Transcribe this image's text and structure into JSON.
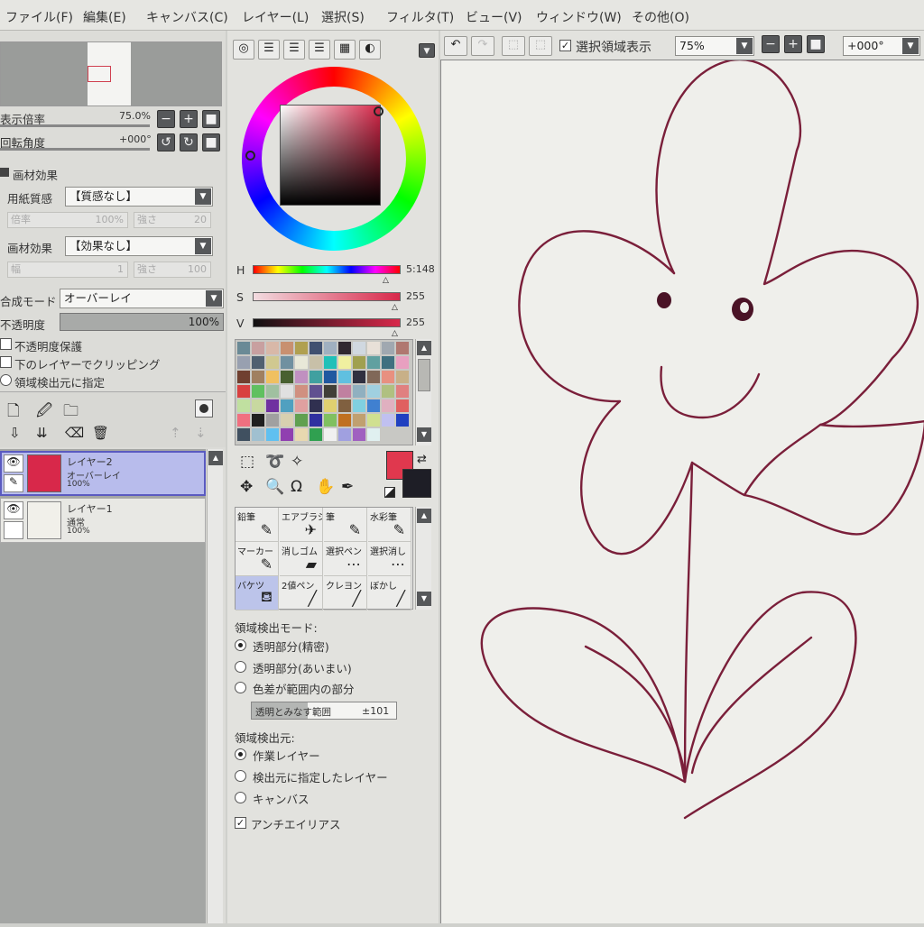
{
  "menu": [
    "ファイル(F)",
    "編集(E)",
    "キャンバス(C)",
    "レイヤー(L)",
    "選択(S)",
    "フィルタ(T)",
    "ビュー(V)",
    "ウィンドウ(W)",
    "その他(O)"
  ],
  "toolbar": {
    "selection_display_label": "選択領域表示",
    "zoom_value": "75%",
    "rotation_value": "+000°"
  },
  "navigator": {
    "zoom_label": "表示倍率",
    "zoom_value": "75.0%",
    "rotation_label": "回転角度",
    "rotation_value": "+000°"
  },
  "effects": {
    "header": "画材効果",
    "paper_label": "用紙質感",
    "paper_value": "【質感なし】",
    "scale_label": "倍率",
    "scale_value": "100%",
    "strength_label": "強さ",
    "strength_value": "20",
    "effect_label": "画材効果",
    "effect_value": "【効果なし】",
    "width_label": "幅",
    "width_value": "1",
    "strength2_label": "強さ",
    "strength2_value": "100"
  },
  "blend": {
    "mode_label": "合成モード",
    "mode_value": "オーバーレイ",
    "opacity_label": "不透明度",
    "opacity_value": "100%",
    "protect_label": "不透明度保護",
    "clip_label": "下のレイヤーでクリッピング",
    "source_label": "領域検出元に指定"
  },
  "layers": [
    {
      "name": "レイヤー2",
      "mode": "オーバーレイ",
      "opacity": "100%",
      "thumb": "#d8284a"
    },
    {
      "name": "レイヤー1",
      "mode": "通常",
      "opacity": "100%",
      "thumb": "#f1f0ea"
    }
  ],
  "color": {
    "h_label": "H",
    "h_value": "5:148",
    "s_label": "S",
    "s_value": "255",
    "v_label": "V",
    "v_value": "255",
    "foreground": "#e0384e",
    "background": "#1e1e26"
  },
  "palette": [
    "#6a8a96",
    "#c8a0a0",
    "#d8b8a8",
    "#c89070",
    "#b0a050",
    "#405070",
    "#a0b0c0",
    "#302830",
    "#d0d8e0",
    "#e8e0d8",
    "#a0a8b0",
    "#b07870",
    "#98a0b0",
    "#506070",
    "#d0c890",
    "#7090a0",
    "#e8e8d8",
    "#c8c0a8",
    "#20c0b8",
    "#f0f0a0",
    "#a0a050",
    "#60a0a0",
    "#407080",
    "#e8a0c0",
    "#704030",
    "#a08060",
    "#f0c060",
    "#486030",
    "#c090c0",
    "#40a0a0",
    "#2058a0",
    "#60c0e0",
    "#303040",
    "#806858",
    "#e89080",
    "#c8b088",
    "#d84040",
    "#60c060",
    "#a0c0a0",
    "#e0e0e0",
    "#d09080",
    "#605090",
    "#404038",
    "#c080a0",
    "#90b0c0",
    "#a0d0e0",
    "#b0c080",
    "#e08080",
    "#c0e0a0",
    "#c8d8a0",
    "#7030a0",
    "#50a0c0",
    "#e0a0a0",
    "#303050",
    "#e0d070",
    "#806040",
    "#80d0e0",
    "#4080d0",
    "#e0b0c0",
    "#e06060",
    "#f07080",
    "#202020",
    "#a0a0a0",
    "#d8d0b0",
    "#60a050",
    "#3030a0",
    "#80c060",
    "#c07020",
    "#c0a070",
    "#d0e090",
    "#c0c0f0",
    "#2040c0",
    "#405060",
    "#a0c0d0",
    "#60c0f0",
    "#9040b0",
    "#e8d8b0",
    "#30a050",
    "#f0f0f0",
    "#a0a0e0",
    "#a060c0",
    "#e0f0f0"
  ],
  "tools": [
    {
      "label": "鉛筆",
      "icon": "✎",
      "icon_name": "pencil-icon"
    },
    {
      "label": "エアブラシ",
      "icon": "✈",
      "icon_name": "airbrush-icon"
    },
    {
      "label": "筆",
      "icon": "✎",
      "icon_name": "brush-icon"
    },
    {
      "label": "水彩筆",
      "icon": "✎",
      "icon_name": "watercolor-icon"
    },
    {
      "label": "マーカー",
      "icon": "✎",
      "icon_name": "marker-icon"
    },
    {
      "label": "消しゴム",
      "icon": "▰",
      "icon_name": "eraser-icon"
    },
    {
      "label": "選択ペン",
      "icon": "⋯",
      "icon_name": "select-pen-icon"
    },
    {
      "label": "選択消し",
      "icon": "⋯",
      "icon_name": "select-eraser-icon"
    },
    {
      "label": "バケツ",
      "icon": "⛾",
      "icon_name": "bucket-icon"
    },
    {
      "label": "2値ペン",
      "icon": "╱",
      "icon_name": "binary-pen-icon"
    },
    {
      "label": "クレヨン",
      "icon": "╱",
      "icon_name": "crayon-icon"
    },
    {
      "label": "ぼかし",
      "icon": "╱",
      "icon_name": "blur-icon"
    }
  ],
  "bucket": {
    "mode_header": "領域検出モード:",
    "mode_opts": [
      "透明部分(精密)",
      "透明部分(あいまい)",
      "色差が範囲内の部分"
    ],
    "range_label": "透明とみなす範囲",
    "range_value": "±101",
    "source_header": "領域検出元:",
    "source_opts": [
      "作業レイヤー",
      "検出元に指定したレイヤー",
      "キャンバス"
    ],
    "antialias_label": "アンチエイリアス"
  }
}
